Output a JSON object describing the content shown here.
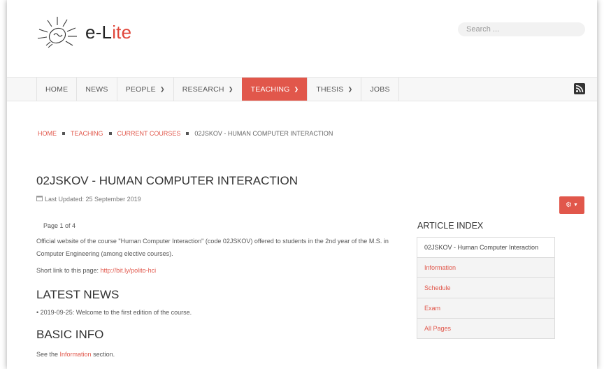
{
  "header": {
    "logo_prefix": "e-L",
    "logo_accent": "ite",
    "search_placeholder": "Search ..."
  },
  "nav": {
    "items": [
      {
        "label": "HOME",
        "has_dropdown": false,
        "active": false
      },
      {
        "label": "NEWS",
        "has_dropdown": false,
        "active": false
      },
      {
        "label": "PEOPLE",
        "has_dropdown": true,
        "active": false
      },
      {
        "label": "RESEARCH",
        "has_dropdown": true,
        "active": false
      },
      {
        "label": "TEACHING",
        "has_dropdown": true,
        "active": true
      },
      {
        "label": "THESIS",
        "has_dropdown": true,
        "active": false
      },
      {
        "label": "JOBS",
        "has_dropdown": false,
        "active": false
      }
    ],
    "rss_icon": "rss-icon"
  },
  "breadcrumb": {
    "home": "HOME",
    "teaching": "TEACHING",
    "current_courses": "CURRENT COURSES",
    "current": "02JSKOV - HUMAN COMPUTER INTERACTION"
  },
  "article": {
    "title": "02JSKOV - HUMAN COMPUTER INTERACTION",
    "last_updated": "Last Updated: 25 September 2019",
    "page_counter": "Page 1 of 4",
    "intro": "Official website of the course \"Human Computer Interaction\" (code 02JSKOV) offered to students in the 2nd year of the M.S. in Computer Engineering (among elective courses).",
    "shortlink_label": "Short link to this page: ",
    "shortlink_url": "http://bit.ly/polito-hci",
    "latest_news_heading": "LATEST NEWS",
    "news_item": "2019-09-25: Welcome to the first edition of the course.",
    "basic_info_heading": "BASIC INFO",
    "see_prefix": "See the ",
    "see_link": "Information",
    "see_suffix": " section."
  },
  "article_index": {
    "title": "ARTICLE INDEX",
    "items": [
      "02JSKOV - Human Computer Interaction",
      "Information",
      "Schedule",
      "Exam",
      "All Pages"
    ]
  },
  "colors": {
    "accent": "#e1574b",
    "nav_bg": "#f7f7f7",
    "text": "#444444"
  }
}
